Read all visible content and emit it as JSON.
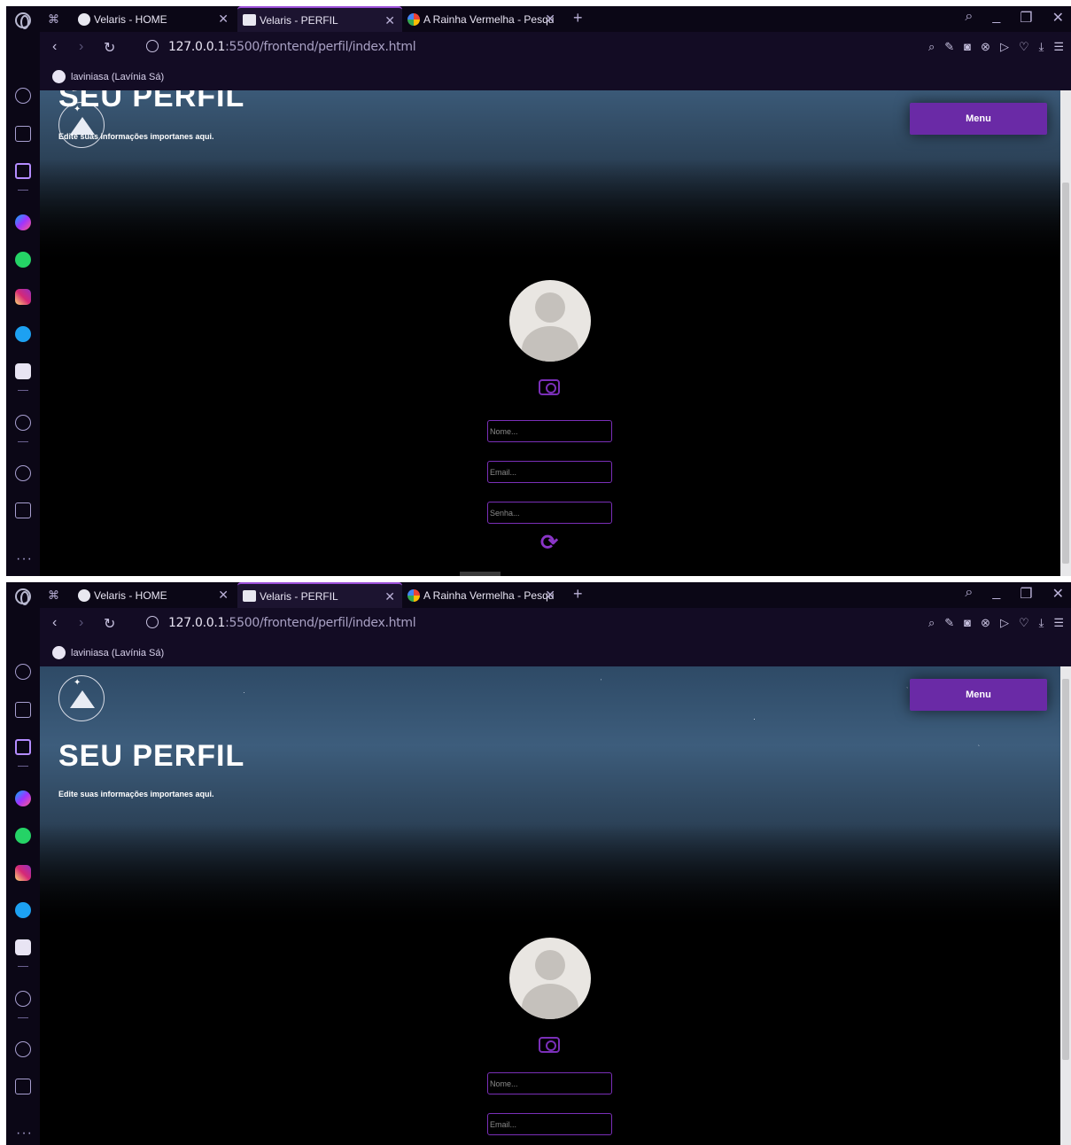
{
  "browser": {
    "tabs": [
      {
        "title": "Velaris - HOME"
      },
      {
        "title": "Velaris - PERFIL"
      },
      {
        "title": "A Rainha Vermelha - Pesqu"
      }
    ],
    "url_host": "127.0.0.1",
    "url_rest": ":5500/frontend/perfil/index.html",
    "bookmark": "laviniasa (Lavínia Sá)"
  },
  "page": {
    "title": "SEU PERFIL",
    "subtitle": "Edite suas informações importanes aqui.",
    "menu_label": "Menu",
    "fields": {
      "nome_placeholder": "Nome...",
      "email_placeholder": "Email...",
      "senha_placeholder": "Senha..."
    }
  },
  "icons": {
    "sidebar": [
      "speedometer-icon",
      "shopping-bag-icon",
      "twitch-icon",
      "messenger-icon",
      "whatsapp-icon",
      "instagram-icon",
      "twitter-icon",
      "discord-icon",
      "player-icon",
      "history-icon",
      "cube-icon",
      "more-icon"
    ],
    "profile": [
      "avatar-placeholder",
      "camera-icon",
      "refresh-icon"
    ]
  },
  "colors": {
    "accent": "#7a2fb8",
    "menu_button": "#6a2aa6",
    "browser_bg": "#0d0818"
  }
}
